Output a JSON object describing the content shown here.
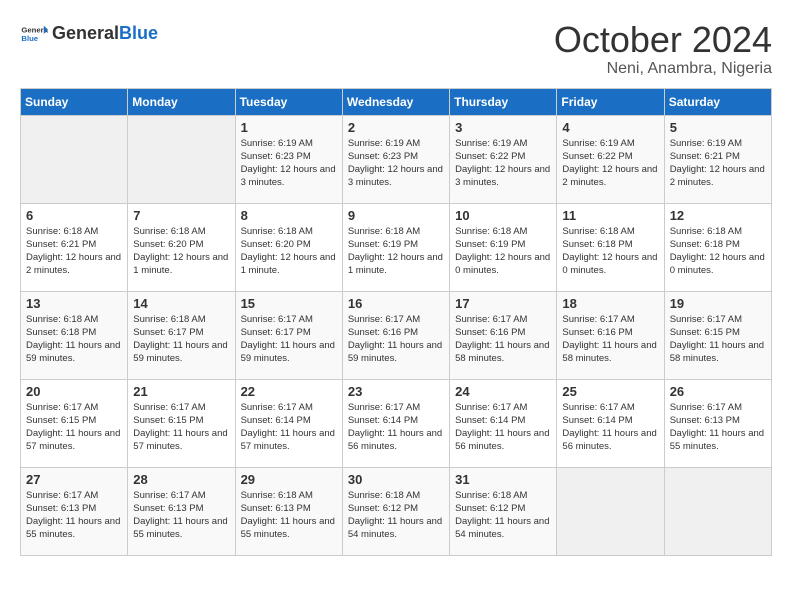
{
  "header": {
    "logo_general": "General",
    "logo_blue": "Blue",
    "month_title": "October 2024",
    "subtitle": "Neni, Anambra, Nigeria"
  },
  "days_of_week": [
    "Sunday",
    "Monday",
    "Tuesday",
    "Wednesday",
    "Thursday",
    "Friday",
    "Saturday"
  ],
  "weeks": [
    {
      "days": [
        {
          "num": "",
          "empty": true
        },
        {
          "num": "",
          "empty": true
        },
        {
          "num": "1",
          "sunrise": "6:19 AM",
          "sunset": "6:23 PM",
          "daylight": "12 hours and 3 minutes."
        },
        {
          "num": "2",
          "sunrise": "6:19 AM",
          "sunset": "6:23 PM",
          "daylight": "12 hours and 3 minutes."
        },
        {
          "num": "3",
          "sunrise": "6:19 AM",
          "sunset": "6:22 PM",
          "daylight": "12 hours and 3 minutes."
        },
        {
          "num": "4",
          "sunrise": "6:19 AM",
          "sunset": "6:22 PM",
          "daylight": "12 hours and 2 minutes."
        },
        {
          "num": "5",
          "sunrise": "6:19 AM",
          "sunset": "6:21 PM",
          "daylight": "12 hours and 2 minutes."
        }
      ]
    },
    {
      "days": [
        {
          "num": "6",
          "sunrise": "6:18 AM",
          "sunset": "6:21 PM",
          "daylight": "12 hours and 2 minutes."
        },
        {
          "num": "7",
          "sunrise": "6:18 AM",
          "sunset": "6:20 PM",
          "daylight": "12 hours and 1 minute."
        },
        {
          "num": "8",
          "sunrise": "6:18 AM",
          "sunset": "6:20 PM",
          "daylight": "12 hours and 1 minute."
        },
        {
          "num": "9",
          "sunrise": "6:18 AM",
          "sunset": "6:19 PM",
          "daylight": "12 hours and 1 minute."
        },
        {
          "num": "10",
          "sunrise": "6:18 AM",
          "sunset": "6:19 PM",
          "daylight": "12 hours and 0 minutes."
        },
        {
          "num": "11",
          "sunrise": "6:18 AM",
          "sunset": "6:18 PM",
          "daylight": "12 hours and 0 minutes."
        },
        {
          "num": "12",
          "sunrise": "6:18 AM",
          "sunset": "6:18 PM",
          "daylight": "12 hours and 0 minutes."
        }
      ]
    },
    {
      "days": [
        {
          "num": "13",
          "sunrise": "6:18 AM",
          "sunset": "6:18 PM",
          "daylight": "11 hours and 59 minutes."
        },
        {
          "num": "14",
          "sunrise": "6:18 AM",
          "sunset": "6:17 PM",
          "daylight": "11 hours and 59 minutes."
        },
        {
          "num": "15",
          "sunrise": "6:17 AM",
          "sunset": "6:17 PM",
          "daylight": "11 hours and 59 minutes."
        },
        {
          "num": "16",
          "sunrise": "6:17 AM",
          "sunset": "6:16 PM",
          "daylight": "11 hours and 59 minutes."
        },
        {
          "num": "17",
          "sunrise": "6:17 AM",
          "sunset": "6:16 PM",
          "daylight": "11 hours and 58 minutes."
        },
        {
          "num": "18",
          "sunrise": "6:17 AM",
          "sunset": "6:16 PM",
          "daylight": "11 hours and 58 minutes."
        },
        {
          "num": "19",
          "sunrise": "6:17 AM",
          "sunset": "6:15 PM",
          "daylight": "11 hours and 58 minutes."
        }
      ]
    },
    {
      "days": [
        {
          "num": "20",
          "sunrise": "6:17 AM",
          "sunset": "6:15 PM",
          "daylight": "11 hours and 57 minutes."
        },
        {
          "num": "21",
          "sunrise": "6:17 AM",
          "sunset": "6:15 PM",
          "daylight": "11 hours and 57 minutes."
        },
        {
          "num": "22",
          "sunrise": "6:17 AM",
          "sunset": "6:14 PM",
          "daylight": "11 hours and 57 minutes."
        },
        {
          "num": "23",
          "sunrise": "6:17 AM",
          "sunset": "6:14 PM",
          "daylight": "11 hours and 56 minutes."
        },
        {
          "num": "24",
          "sunrise": "6:17 AM",
          "sunset": "6:14 PM",
          "daylight": "11 hours and 56 minutes."
        },
        {
          "num": "25",
          "sunrise": "6:17 AM",
          "sunset": "6:14 PM",
          "daylight": "11 hours and 56 minutes."
        },
        {
          "num": "26",
          "sunrise": "6:17 AM",
          "sunset": "6:13 PM",
          "daylight": "11 hours and 55 minutes."
        }
      ]
    },
    {
      "days": [
        {
          "num": "27",
          "sunrise": "6:17 AM",
          "sunset": "6:13 PM",
          "daylight": "11 hours and 55 minutes."
        },
        {
          "num": "28",
          "sunrise": "6:17 AM",
          "sunset": "6:13 PM",
          "daylight": "11 hours and 55 minutes."
        },
        {
          "num": "29",
          "sunrise": "6:18 AM",
          "sunset": "6:13 PM",
          "daylight": "11 hours and 55 minutes."
        },
        {
          "num": "30",
          "sunrise": "6:18 AM",
          "sunset": "6:12 PM",
          "daylight": "11 hours and 54 minutes."
        },
        {
          "num": "31",
          "sunrise": "6:18 AM",
          "sunset": "6:12 PM",
          "daylight": "11 hours and 54 minutes."
        },
        {
          "num": "",
          "empty": true
        },
        {
          "num": "",
          "empty": true
        }
      ]
    }
  ]
}
